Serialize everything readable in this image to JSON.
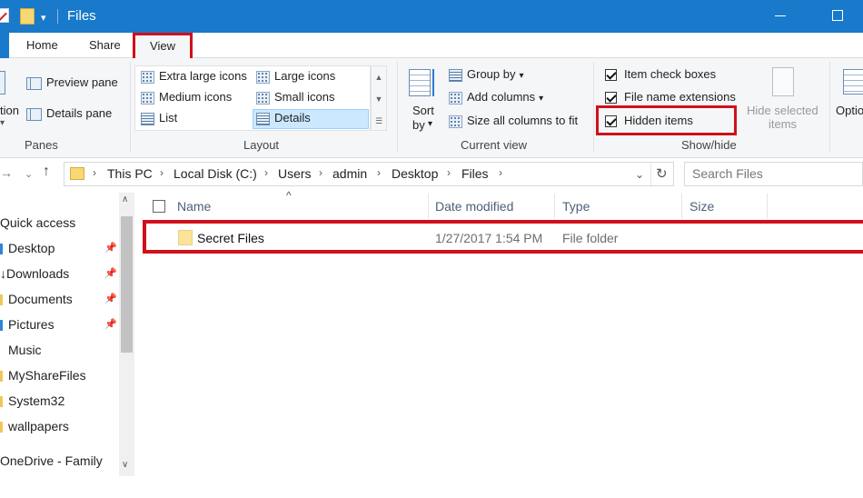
{
  "window": {
    "title": "Files"
  },
  "ribbon_tabs": {
    "home": "Home",
    "share": "Share",
    "view": "View"
  },
  "panes_group": {
    "label": "Panes",
    "preview_pane": "Preview pane",
    "details_pane": "Details pane",
    "nav_partial": "tion"
  },
  "layout_group": {
    "label": "Layout",
    "options": [
      "Extra large icons",
      "Large icons",
      "Medium icons",
      "Small icons",
      "List",
      "Details"
    ],
    "selected": "Details"
  },
  "current_view_group": {
    "label": "Current view",
    "sort_by": "Sort",
    "sort_by_2": "by",
    "group_by": "Group by",
    "add_columns": "Add columns",
    "size_columns": "Size all columns to fit"
  },
  "show_hide_group": {
    "label": "Show/hide",
    "item_check_boxes": "Item check boxes",
    "file_name_extensions": "File name extensions",
    "hidden_items": "Hidden items",
    "hide_selected_1": "Hide selected",
    "hide_selected_2": "items",
    "checked": {
      "item_check_boxes": true,
      "file_name_extensions": true,
      "hidden_items": true
    }
  },
  "options_partial": "Optio",
  "address": {
    "crumbs": [
      "This PC",
      "Local Disk (C:)",
      "Users",
      "admin",
      "Desktop",
      "Files"
    ],
    "search_placeholder": "Search Files"
  },
  "nav_pane": {
    "items": [
      {
        "label": "Quick access",
        "pinned": false
      },
      {
        "label": "Desktop",
        "pinned": true
      },
      {
        "label": "Downloads",
        "pinned": true
      },
      {
        "label": "Documents",
        "pinned": true
      },
      {
        "label": "Pictures",
        "pinned": true
      },
      {
        "label": "Music",
        "pinned": false
      },
      {
        "label": "MyShareFiles",
        "pinned": false
      },
      {
        "label": "System32",
        "pinned": false
      },
      {
        "label": "wallpapers",
        "pinned": false
      },
      {
        "label": "OneDrive - Family",
        "pinned": false
      }
    ]
  },
  "file_list": {
    "columns": [
      "Name",
      "Date modified",
      "Type",
      "Size"
    ],
    "rows": [
      {
        "name": "Secret Files",
        "date_modified": "1/27/2017 1:54 PM",
        "type": "File folder",
        "size": ""
      }
    ]
  },
  "colors": {
    "accent": "#1979ca",
    "highlight": "#d0101a",
    "selection": "#cce8ff"
  }
}
